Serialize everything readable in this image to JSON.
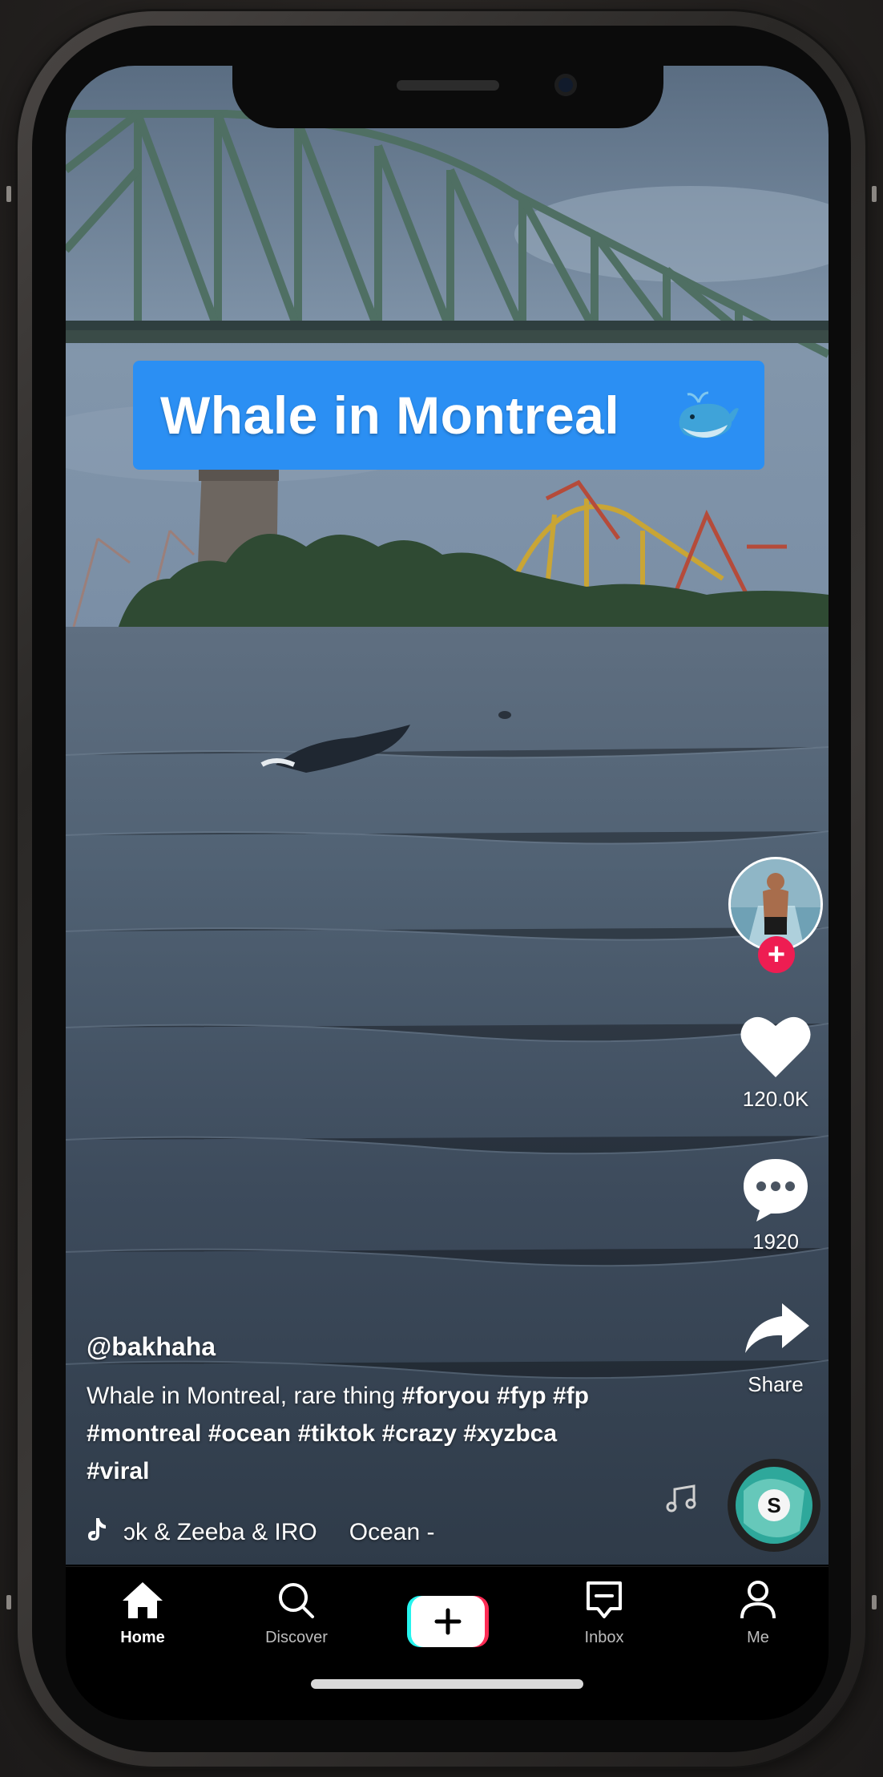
{
  "video": {
    "title_banner": "Whale in Montreal",
    "title_emoji": "whale-icon"
  },
  "actions": {
    "likes": "120.0K",
    "comments": "1920",
    "share_label": "Share"
  },
  "post": {
    "username": "@bakhaha",
    "caption_text": "Whale in Montreal, rare thing",
    "hashtags": [
      "#foryou",
      "#fyp",
      "#fp",
      "#montreal",
      "#ocean",
      "#tiktok",
      "#crazy",
      "#xyzbca",
      "#viral"
    ],
    "sound_1": "ɔk & Zeeba & IRO",
    "sound_2": "Ocean -"
  },
  "tabs": [
    {
      "label": "Home",
      "icon": "home-icon",
      "active": true
    },
    {
      "label": "Discover",
      "icon": "search-icon",
      "active": false
    },
    {
      "label": "",
      "icon": "plus-icon",
      "active": false
    },
    {
      "label": "Inbox",
      "icon": "inbox-icon",
      "active": false
    },
    {
      "label": "Me",
      "icon": "person-icon",
      "active": false
    }
  ],
  "colors": {
    "title_banner": "#2b8ff3",
    "follow_plus": "#ee1d52",
    "create_cyan": "#25f4ee",
    "create_red": "#fe2c55"
  }
}
